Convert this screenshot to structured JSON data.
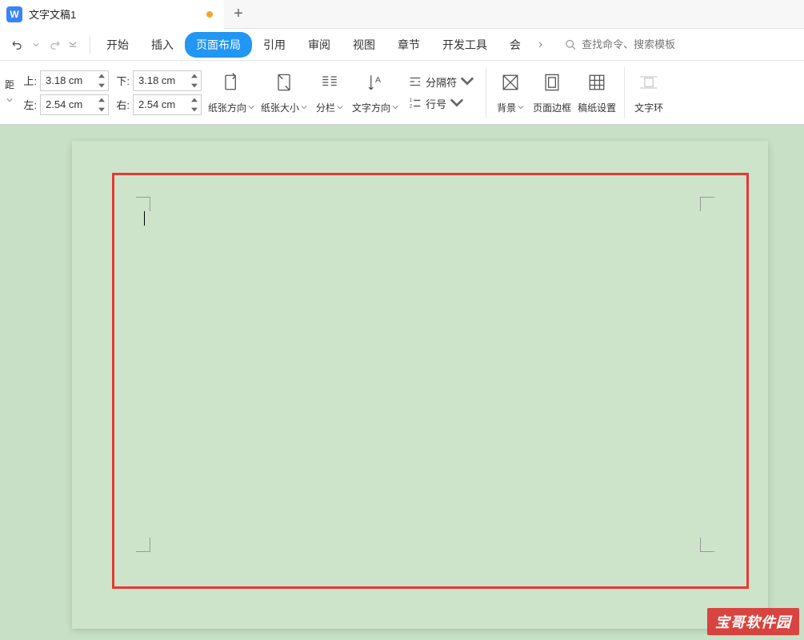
{
  "tab": {
    "title": "文字文稿1"
  },
  "menu": {
    "items": [
      "开始",
      "插入",
      "页面布局",
      "引用",
      "审阅",
      "视图",
      "章节",
      "开发工具",
      "会"
    ],
    "active_index": 2,
    "more": "›"
  },
  "search": {
    "placeholder": "查找命令、搜索模板"
  },
  "margins": {
    "top_label": "上:",
    "top_value": "3.18 cm",
    "bottom_label": "下:",
    "bottom_value": "3.18 cm",
    "left_label": "左:",
    "left_value": "2.54 cm",
    "right_label": "右:",
    "right_value": "2.54 cm",
    "margin_btn": "距"
  },
  "ribbon": {
    "orientation": "纸张方向",
    "size": "纸张大小",
    "columns": "分栏",
    "text_direction": "文字方向",
    "breaks": "分隔符",
    "line_numbers": "行号",
    "background": "背景",
    "page_border": "页面边框",
    "grid_paper": "稿纸设置",
    "text_wrap": "文字环"
  },
  "watermark": "宝哥软件园"
}
